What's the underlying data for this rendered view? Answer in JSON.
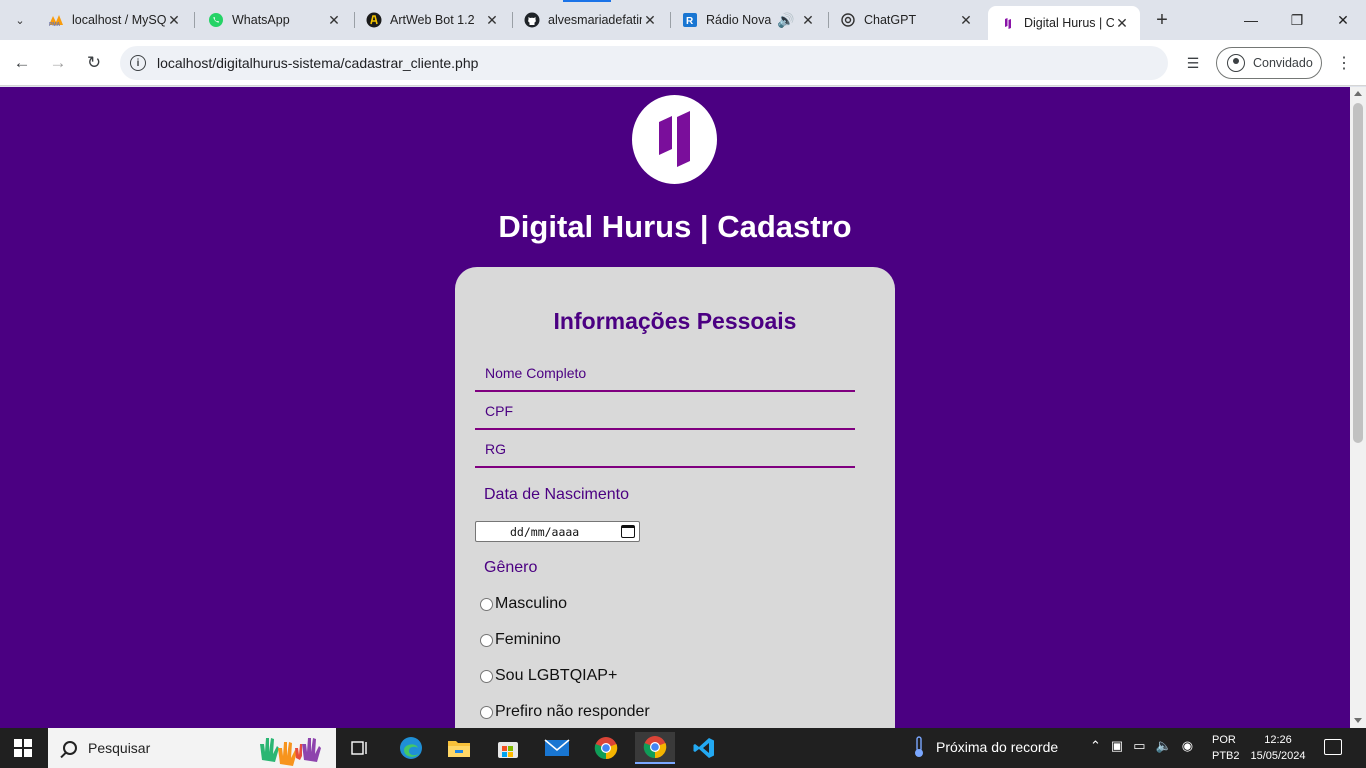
{
  "browser": {
    "tabs": [
      {
        "title": "localhost / MySQL",
        "favicon": "phpmyadmin-icon"
      },
      {
        "title": "WhatsApp",
        "favicon": "whatsapp-icon"
      },
      {
        "title": "ArtWeb Bot 1.2",
        "favicon": "artweb-icon"
      },
      {
        "title": "alvesmariadefatima",
        "favicon": "github-icon"
      },
      {
        "title": "Rádio Nova",
        "favicon": "radio-icon"
      },
      {
        "title": "ChatGPT",
        "favicon": "chatgpt-icon"
      },
      {
        "title": "Digital Hurus | Cadastro",
        "favicon": "digital-hurus-icon"
      }
    ],
    "url": "localhost/digitalhurus-sistema/cadastrar_cliente.php",
    "profile_label": "Convidado"
  },
  "page": {
    "site_title": "Digital Hurus | Cadastro",
    "form": {
      "section_title": "Informações Pessoais",
      "fields": {
        "name_placeholder": "Nome Completo",
        "cpf_placeholder": "CPF",
        "rg_placeholder": "RG"
      },
      "birth_label": "Data de Nascimento",
      "birth_value": "dd/mm/aaaa",
      "gender_label": "Gênero",
      "gender_options": [
        "Masculino",
        "Feminino",
        "Sou LGBTQIAP+",
        "Prefiro não responder"
      ]
    }
  },
  "taskbar": {
    "search_placeholder": "Pesquisar",
    "weather": "Próxima do recorde",
    "lang_top": "POR",
    "lang_bottom": "PTB2",
    "time": "12:26",
    "date": "15/05/2024"
  },
  "colors": {
    "page_background": "#4b0082",
    "card_background": "#d9d9d9",
    "accent": "#800080"
  }
}
